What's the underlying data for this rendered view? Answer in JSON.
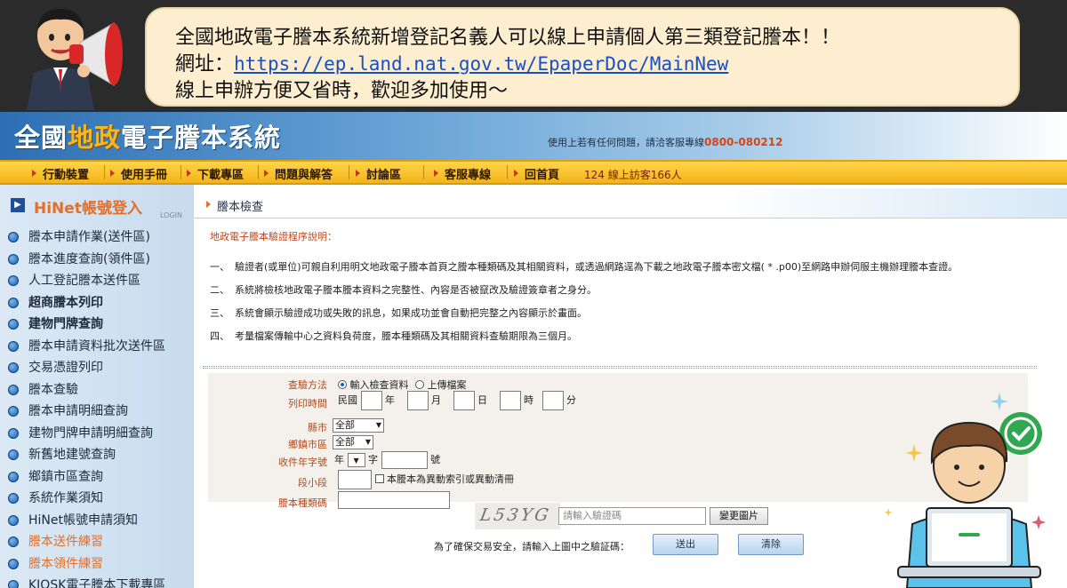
{
  "announcement": {
    "line1": "全國地政電子謄本系統新增登記名義人可以線上申請個人第三類登記謄本！！",
    "line2_prefix": "網址：",
    "line2_url": "https://ep.land.nat.gov.tw/EpaperDoc/MainNew",
    "line3": "線上申辦方便又省時，歡迎多加使用～"
  },
  "header": {
    "logo_part1": "全國",
    "logo_part2": "地政",
    "logo_part3": "電子謄本系統",
    "hotline_text": "使用上若有任何問題，請洽客服專線",
    "hotline_number": "0800-080212"
  },
  "nav": {
    "items": [
      "行動裝置",
      "使用手冊",
      "下載專區",
      "問題與解答",
      "討論區",
      "客服專線",
      "回首頁"
    ],
    "visitors": "124  線上訪客166人"
  },
  "sidebar": {
    "login_label": "HiNet帳號登入",
    "login_sub": "LOGIN",
    "items": [
      {
        "label": "謄本申請作業(送件區)"
      },
      {
        "label": "謄本進度查詢(領件區)"
      },
      {
        "label": "人工登記謄本送件區"
      },
      {
        "label": "超商謄本列印"
      },
      {
        "label": "建物門牌查詢"
      },
      {
        "label": "謄本申請資料批次送件區"
      },
      {
        "label": "交易憑證列印"
      },
      {
        "label": "謄本查驗"
      },
      {
        "label": "謄本申請明細查詢"
      },
      {
        "label": "建物門牌申請明細查詢"
      },
      {
        "label": "新舊地建號查詢"
      },
      {
        "label": "鄉鎮市區查詢"
      },
      {
        "label": "系統作業須知"
      },
      {
        "label": "HiNet帳號申請須知"
      },
      {
        "label": "謄本送件練習"
      },
      {
        "label": "謄本領件練習"
      },
      {
        "label": "KIOSK電子謄本下載專區"
      }
    ]
  },
  "main": {
    "breadcrumb": "謄本檢查",
    "desc_title": "地政電子謄本驗證程序說明：",
    "desc_items": [
      {
        "num": "一、",
        "text": "驗證者(或單位)可親自利用明文地政電子謄本首頁之謄本種類碼及其相關資料，或透過網路逕為下載之地政電子謄本密文檔( * .p00)至網路申辦伺服主機辦理謄本查證。"
      },
      {
        "num": "二、",
        "text": "系統將檢核地政電子謄本謄本資料之完整性、內容是否被竄改及驗證簽章者之身分。"
      },
      {
        "num": "三、",
        "text": "系統會顯示驗證成功或失敗的訊息，如果成功並會自動把完整之內容顯示於畫面。"
      },
      {
        "num": "四、",
        "text": "考量檔案傳輸中心之資料負荷度，謄本種類碼及其相關資料查驗期限為三個月。"
      }
    ],
    "form": {
      "method_label": "查驗方法",
      "method_opt1": "輸入檢查資料",
      "method_opt2": "上傳檔案",
      "print_time_label": "列印時間",
      "era": "民國",
      "unit_year": "年",
      "unit_month": "月",
      "unit_day": "日",
      "unit_hour": "時",
      "unit_min": "分",
      "county_label": "縣市",
      "county_value": "全部",
      "town_label": "鄉鎮市區",
      "town_value": "全部",
      "receipt_label": "收件年字號",
      "receipt_year": "年",
      "receipt_char": "字",
      "receipt_num": "號",
      "section_label": "段小段",
      "checkbox_label": "本謄本為異動索引或異動清冊",
      "code_label": "謄本種類碼",
      "captcha_text": "L53YG",
      "captcha_placeholder": "請輸入驗證碼",
      "refresh_button": "變更圖片",
      "security_note": "為了確保交易安全，請輸入上圖中之驗証碼：",
      "submit_button": "送出",
      "clear_button": "清除"
    }
  }
}
